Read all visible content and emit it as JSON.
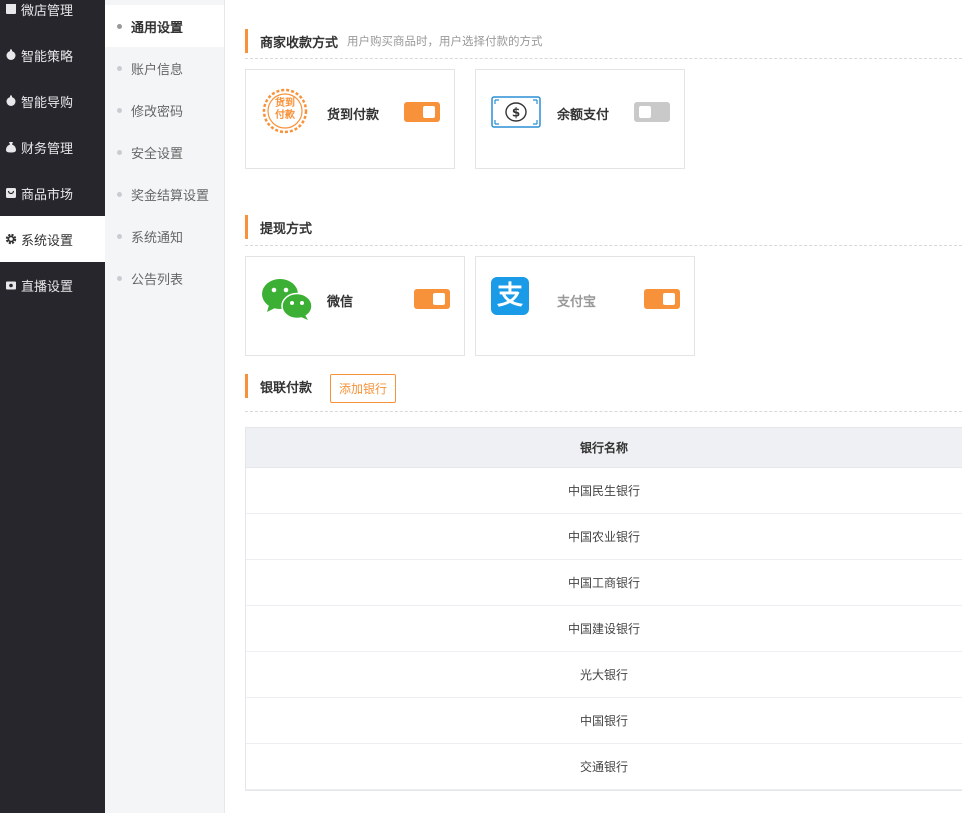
{
  "sidebar": {
    "items": [
      {
        "label": "微店管理",
        "icon": "shop-icon"
      },
      {
        "label": "智能策略",
        "icon": "strategy-icon"
      },
      {
        "label": "智能导购",
        "icon": "guide-icon"
      },
      {
        "label": "财务管理",
        "icon": "money-bag-icon"
      },
      {
        "label": "商品市场",
        "icon": "market-icon"
      },
      {
        "label": "系统设置",
        "icon": "gear-icon",
        "active": true
      },
      {
        "label": "直播设置",
        "icon": "live-icon"
      }
    ]
  },
  "subnav": {
    "items": [
      {
        "label": "通用设置",
        "active": true
      },
      {
        "label": "账户信息"
      },
      {
        "label": "修改密码"
      },
      {
        "label": "安全设置"
      },
      {
        "label": "奖金结算设置"
      },
      {
        "label": "系统通知"
      },
      {
        "label": "公告列表"
      }
    ]
  },
  "payment": {
    "title": "商家收款方式",
    "subtitle": "用户购买商品时，用户选择付款的方式",
    "cards": [
      {
        "label": "货到付款",
        "icon_text": [
          "货到",
          "付款"
        ],
        "icon": "cod-stamp-icon",
        "enabled": true
      },
      {
        "label": "余额支付",
        "icon": "cash-note-icon",
        "enabled": false
      }
    ]
  },
  "withdraw": {
    "title": "提现方式",
    "cards": [
      {
        "label": "微信",
        "icon": "wechat-icon",
        "enabled": true
      },
      {
        "label": "支付宝",
        "icon": "alipay-icon",
        "icon_text": "支",
        "enabled": true
      }
    ]
  },
  "unionpay": {
    "title": "银联付款",
    "add_button": "添加银行"
  },
  "bank_table": {
    "header": "银行名称",
    "rows": [
      "中国民生银行",
      "中国农业银行",
      "中国工商银行",
      "中国建设银行",
      "光大银行",
      "中国银行",
      "交通银行"
    ]
  },
  "colors": {
    "accent": "#f7923a",
    "sidebar_bg": "#26262c",
    "wechat_green": "#3cb034",
    "alipay_blue": "#1a9be8"
  }
}
